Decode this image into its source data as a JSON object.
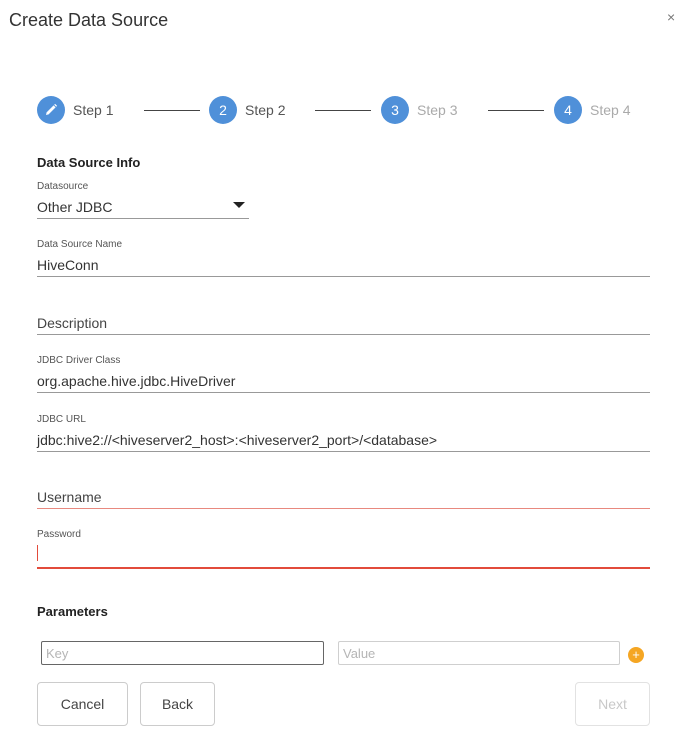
{
  "dialog": {
    "title": "Create Data Source",
    "close_symbol": "×"
  },
  "stepper": {
    "steps": [
      {
        "badge": "",
        "label": "Step 1",
        "state": "current",
        "icon": "pencil-icon"
      },
      {
        "badge": "2",
        "label": "Step 2",
        "state": "active"
      },
      {
        "badge": "3",
        "label": "Step 3",
        "state": "future"
      },
      {
        "badge": "4",
        "label": "Step 4",
        "state": "future"
      }
    ]
  },
  "section": {
    "title": "Data Source Info"
  },
  "fields": {
    "datasource": {
      "label": "Datasource",
      "value": "Other JDBC"
    },
    "name": {
      "label": "Data Source Name",
      "value": "HiveConn"
    },
    "description": {
      "placeholder": "Description"
    },
    "driver_class": {
      "label": "JDBC Driver Class",
      "value": "org.apache.hive.jdbc.HiveDriver"
    },
    "jdbc_url": {
      "label": "JDBC URL",
      "value": "jdbc:hive2://<hiveserver2_host>:<hiveserver2_port>/<database>"
    },
    "username": {
      "placeholder": "Username"
    },
    "password": {
      "label": "Password",
      "value": ""
    }
  },
  "parameters": {
    "title": "Parameters",
    "key_placeholder": "Key",
    "value_placeholder": "Value",
    "add_symbol": "+"
  },
  "buttons": {
    "cancel": "Cancel",
    "back": "Back",
    "next": "Next"
  },
  "colors": {
    "step_blue": "#4f90d9",
    "error_red": "#e24b3b",
    "add_orange": "#f5a623"
  }
}
